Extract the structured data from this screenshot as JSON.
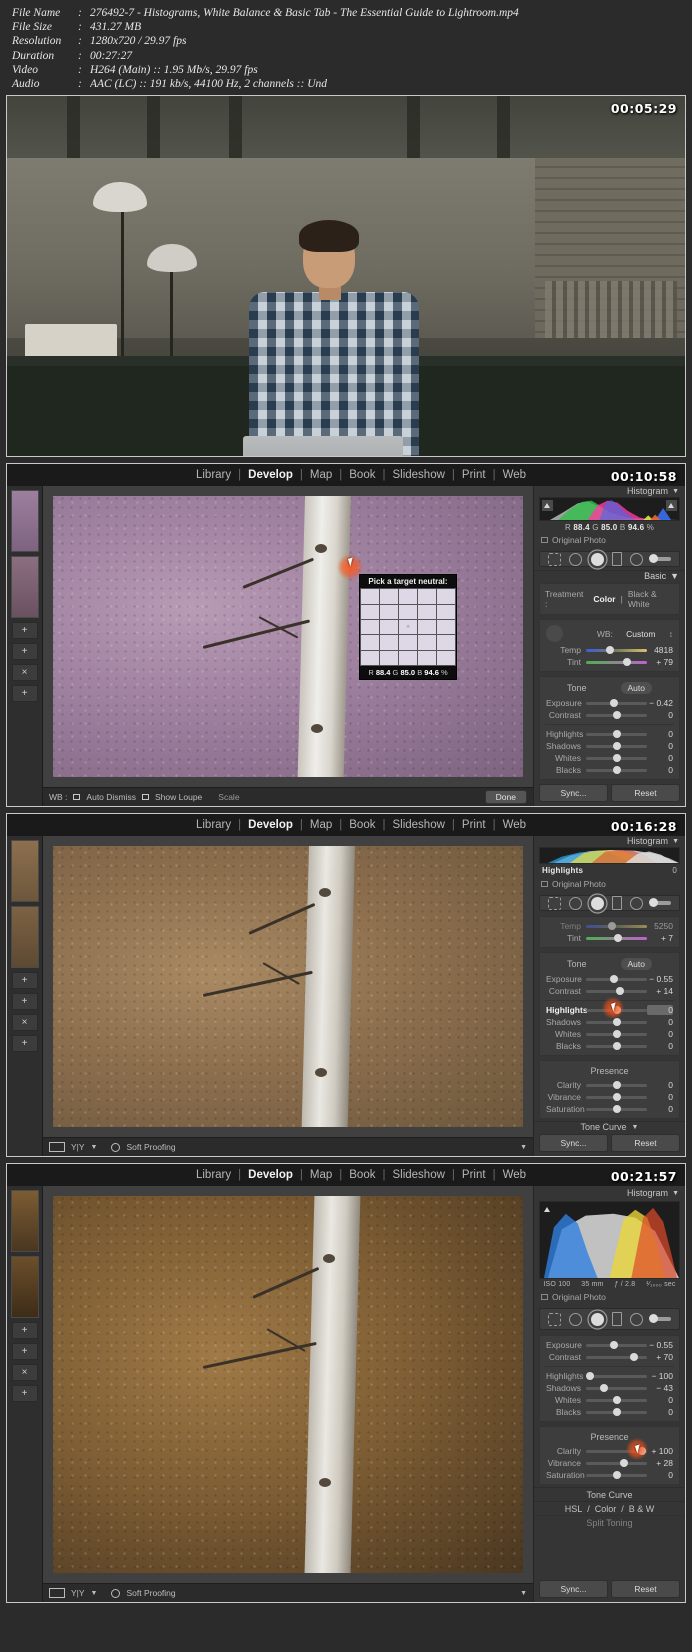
{
  "mediainfo": {
    "rows": [
      {
        "key": "File Name",
        "value": "276492-7 - Histograms, White Balance & Basic Tab - The Essential Guide to Lightroom.mp4"
      },
      {
        "key": "File Size",
        "value": "431.27 MB"
      },
      {
        "key": "Resolution",
        "value": "1280x720 / 29.97 fps"
      },
      {
        "key": "Duration",
        "value": "00:27:27"
      },
      {
        "key": "Video",
        "value": "H264 (Main) :: 1.95 Mb/s, 29.97 fps"
      },
      {
        "key": "Audio",
        "value": "AAC (LC) :: 191 kb/s, 44100 Hz, 2 channels :: Und"
      }
    ],
    "colon": ":"
  },
  "modules": {
    "items": [
      "Library",
      "Develop",
      "Map",
      "Book",
      "Slideshow",
      "Print",
      "Web"
    ],
    "active": "Develop",
    "separator": "|"
  },
  "shots": [
    {
      "timestamp": "00:05:29"
    },
    {
      "timestamp": "00:10:58"
    },
    {
      "timestamp": "00:16:28"
    },
    {
      "timestamp": "00:21:57"
    }
  ],
  "panel2": {
    "histogram": {
      "title": "Histogram",
      "caret": "▼",
      "readout": {
        "r_label": "R",
        "r": "88.4",
        "g_label": "G",
        "g": "85.0",
        "b_label": "B",
        "b": "94.6",
        "unit": "%"
      }
    },
    "original_photo": "Original Photo",
    "basic": {
      "title": "Basic",
      "caret": "▼"
    },
    "treatment": {
      "label": "Treatment :",
      "color": "Color",
      "bw": "Black & White",
      "sep": "|"
    },
    "wb": {
      "label": "WB:",
      "value": "Custom",
      "stepper": "↕"
    },
    "sliders_wb": [
      {
        "label": "Temp",
        "value": "4818",
        "pos": 40
      },
      {
        "label": "Tint",
        "value": "+ 79",
        "pos": 68
      }
    ],
    "tone": {
      "label": "Tone",
      "auto": "Auto"
    },
    "sliders_tone": [
      {
        "label": "Exposure",
        "value": "− 0.42",
        "pos": 46
      },
      {
        "label": "Contrast",
        "value": "0",
        "pos": 50
      }
    ],
    "sliders_tone2": [
      {
        "label": "Highlights",
        "value": "0",
        "pos": 50
      },
      {
        "label": "Shadows",
        "value": "0",
        "pos": 50
      },
      {
        "label": "Whites",
        "value": "0",
        "pos": 50
      },
      {
        "label": "Blacks",
        "value": "0",
        "pos": 50
      }
    ],
    "loupe": {
      "title": "Pick a target neutral:",
      "readout": {
        "r_label": "R",
        "r": "88.4",
        "g_label": "G",
        "g": "85.0",
        "b_label": "B",
        "b": "94.6",
        "unit": "%"
      }
    },
    "toolbar": {
      "wb_label": "WB :",
      "auto_dismiss": "Auto Dismiss",
      "show_loupe": "Show Loupe",
      "scale": "Scale",
      "done": "Done"
    },
    "sync": {
      "sync": "Sync...",
      "reset": "Reset"
    }
  },
  "panel3": {
    "histogram": {
      "title": "Histogram",
      "caret": "▼"
    },
    "hist_label": {
      "name": "Highlights",
      "value": "0"
    },
    "original_photo": "Original Photo",
    "sliders_wb": [
      {
        "label": "Temp",
        "value": "5250",
        "pos": 42
      },
      {
        "label": "Tint",
        "value": "+ 7",
        "pos": 53
      }
    ],
    "tone": {
      "label": "Tone",
      "auto": "Auto"
    },
    "sliders_tone": [
      {
        "label": "Exposure",
        "value": "− 0.55",
        "pos": 46
      },
      {
        "label": "Contrast",
        "value": "+ 14",
        "pos": 56
      }
    ],
    "sliders_tone2": [
      {
        "label": "Highlights",
        "value": "0",
        "pos": 50
      },
      {
        "label": "Shadows",
        "value": "0",
        "pos": 50
      },
      {
        "label": "Whites",
        "value": "0",
        "pos": 50
      },
      {
        "label": "Blacks",
        "value": "0",
        "pos": 50
      }
    ],
    "presence": {
      "title": "Presence"
    },
    "sliders_presence": [
      {
        "label": "Clarity",
        "value": "0",
        "pos": 50
      },
      {
        "label": "Vibrance",
        "value": "0",
        "pos": 50
      },
      {
        "label": "Saturation",
        "value": "0",
        "pos": 50
      }
    ],
    "tonecurve": {
      "title": "Tone Curve",
      "caret": "▼"
    },
    "toolbar": {
      "soft_proofing": "Soft Proofing",
      "yy": "Y|Y",
      "caret": "▼"
    },
    "sync": {
      "sync": "Sync...",
      "reset": "Reset"
    }
  },
  "panel4": {
    "histogram": {
      "title": "Histogram",
      "caret": "▼"
    },
    "exif": {
      "iso": "ISO 100",
      "focal": "35 mm",
      "aperture": "ƒ / 2.8",
      "shutter": "¹⁄₁₀₀₀ sec"
    },
    "original_photo": "Original Photo",
    "sliders_tone": [
      {
        "label": "Exposure",
        "value": "− 0.55",
        "pos": 46
      },
      {
        "label": "Contrast",
        "value": "+ 70",
        "pos": 78
      }
    ],
    "sliders_tone2": [
      {
        "label": "Highlights",
        "value": "− 100",
        "pos": 6
      },
      {
        "label": "Shadows",
        "value": "− 43",
        "pos": 30
      },
      {
        "label": "Whites",
        "value": "0",
        "pos": 50
      },
      {
        "label": "Blacks",
        "value": "0",
        "pos": 50
      }
    ],
    "presence": {
      "title": "Presence"
    },
    "sliders_presence": [
      {
        "label": "Clarity",
        "value": "+ 100",
        "pos": 92
      },
      {
        "label": "Vibrance",
        "value": "+ 28",
        "pos": 62
      },
      {
        "label": "Saturation",
        "value": "0",
        "pos": 50
      }
    ],
    "tonecurve": {
      "title": "Tone Curve",
      "caret": ""
    },
    "hsl": {
      "hsl": "HSL",
      "color": "Color",
      "bw": "B & W",
      "sep": "/"
    },
    "splittone": {
      "title": "Split Toning"
    },
    "toolbar": {
      "soft_proofing": "Soft Proofing",
      "yy": "Y|Y",
      "caret": "▼"
    },
    "sync": {
      "sync": "Sync...",
      "reset": "Reset"
    }
  }
}
